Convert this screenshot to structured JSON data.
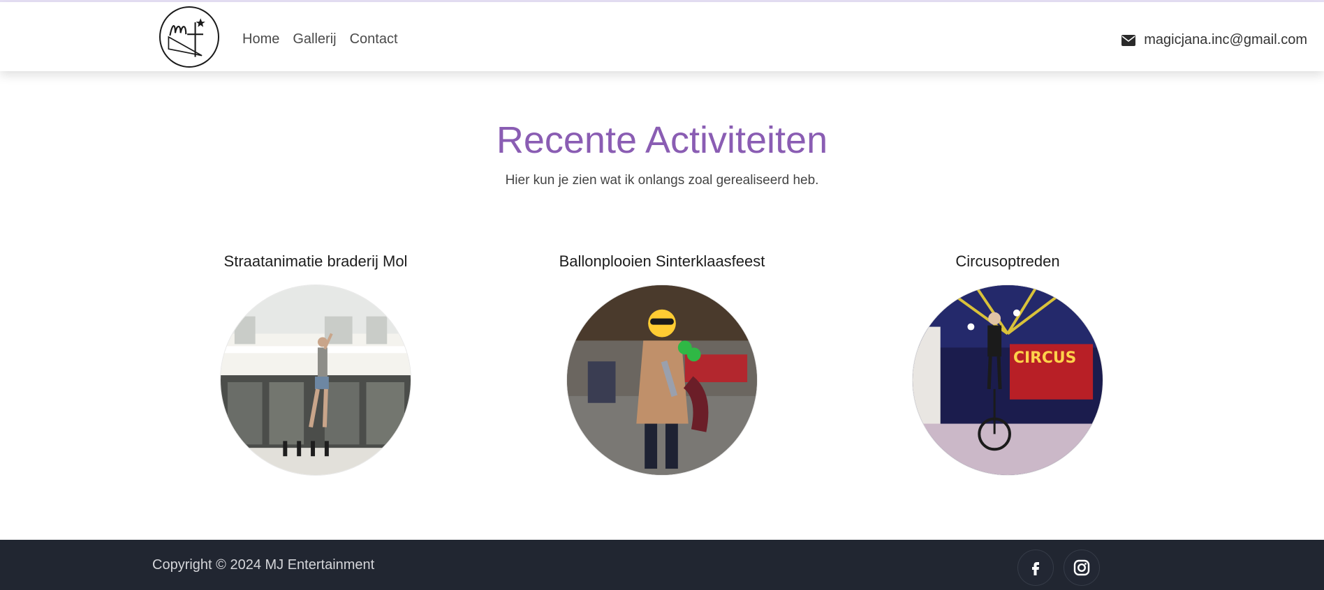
{
  "header": {
    "logo_icon": "mj-logo",
    "nav": [
      {
        "label": "Home"
      },
      {
        "label": "Gallerij"
      },
      {
        "label": "Contact"
      }
    ],
    "email": "magicjana.inc@gmail.com",
    "email_icon": "envelope-icon"
  },
  "main": {
    "title": "Recente Activiteiten",
    "subtitle": "Hier kun je zien wat ik onlangs zoal gerealiseerd heb.",
    "cards": [
      {
        "title": "Straatanimatie braderij Mol"
      },
      {
        "title": "Ballonplooien Sinterklaasfeest"
      },
      {
        "title": "Circusoptreden"
      }
    ]
  },
  "footer": {
    "copyright": "Copyright © 2024 MJ Entertainment",
    "social": [
      "facebook-icon",
      "instagram-icon"
    ]
  },
  "colors": {
    "accent": "#8a5db3",
    "footer_bg": "#212631"
  }
}
